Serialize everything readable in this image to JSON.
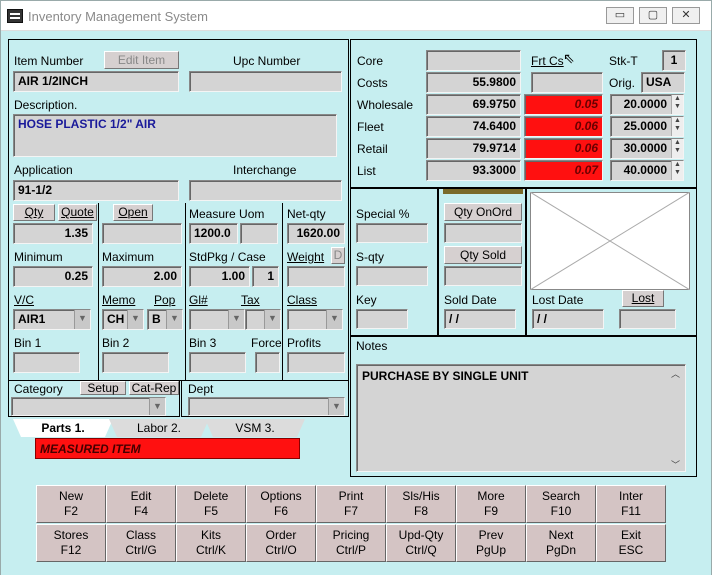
{
  "window": {
    "title": "Inventory Management System",
    "min": "▭",
    "max": "▢",
    "close": "✕"
  },
  "left": {
    "item_number_label": "Item Number",
    "edit_item": "Edit Item",
    "upc_label": "Upc  Number",
    "item_number": "AIR 1/2INCH",
    "upc": "",
    "description_label": "Description.",
    "description": "HOSE PLASTIC 1/2\" AIR",
    "application_label": "Application",
    "interchange_label": "Interchange",
    "application": "91-1/2",
    "interchange": "",
    "qty_btn": "Qty",
    "quote_btn": "Quote",
    "open_btn": "Open",
    "measure_uom_label": "Measure Uom",
    "net_qty_label": "Net-qty",
    "qty": "1.35",
    "open": "",
    "measure_uom": "1200.0",
    "net_qty": "1620.00",
    "minimum_label": "Minimum",
    "maximum_label": "Maximum",
    "stdpkg_label": "StdPkg / Case",
    "weight_label": "Weight",
    "d_label": "D",
    "minimum": "0.25",
    "maximum": "2.00",
    "stdpkg": "1.00",
    "case": "1",
    "weight": "",
    "vc_label": "V/C",
    "memo_label": "Memo",
    "pop_label": "Pop",
    "gl_label": "Gl#",
    "tax_label": "Tax",
    "class_label": "Class",
    "vc": "AIR1",
    "memo": "CH",
    "pop": "B",
    "gl": "",
    "tax": "",
    "class": "",
    "bin1_label": "Bin 1",
    "bin2_label": "Bin 2",
    "bin3_label": "Bin 3",
    "force_label": "Force",
    "profits_label": "Profits",
    "bin1": "",
    "bin2": "",
    "bin3": "",
    "force": "",
    "profits": ""
  },
  "category": {
    "label": "Category",
    "setup": "Setup",
    "catrep": "Cat-Rep",
    "dept_label": "Dept",
    "value": "",
    "dept": ""
  },
  "tabs": [
    {
      "label": "Parts 1."
    },
    {
      "label": "Labor 2."
    },
    {
      "label": "VSM 3."
    }
  ],
  "alert": "MEASURED ITEM",
  "pricing": {
    "core_label": "Core",
    "frt_label": "Frt Cs",
    "stkt_label": "Stk-T",
    "stkt": "1",
    "orig_label": "Orig.",
    "orig": "USA",
    "core": "",
    "frt": "",
    "costs_label": "Costs",
    "costs": "55.9800",
    "rows": [
      {
        "label": "Wholesale",
        "value": "69.9750",
        "margin": "0.05",
        "pct": "20.0000"
      },
      {
        "label": "Fleet",
        "value": "74.6400",
        "margin": "0.06",
        "pct": "25.0000"
      },
      {
        "label": "Retail",
        "value": "79.9714",
        "margin": "0.06",
        "pct": "30.0000"
      },
      {
        "label": "List",
        "value": "93.3000",
        "margin": "0.07",
        "pct": "40.0000"
      }
    ]
  },
  "mid": {
    "special_label": "Special %",
    "qty_onord": "Qty OnOrd",
    "sqty_label": "S-qty",
    "qty_sold": "Qty Sold",
    "key_label": "Key",
    "sold_date_label": "Sold Date",
    "lost_date_label": "Lost Date",
    "lost_btn": "Lost",
    "special": "",
    "onord": "",
    "sqty": "",
    "sold": "",
    "key": "",
    "sold_date": " / /",
    "lost_date": " / /",
    "lost": ""
  },
  "notes": {
    "label": "Notes",
    "text": "PURCHASE BY SINGLE UNIT"
  },
  "fkeys": [
    {
      "l1": "New",
      "l2": "F2"
    },
    {
      "l1": "Edit",
      "l2": "F4"
    },
    {
      "l1": "Delete",
      "l2": "F5"
    },
    {
      "l1": "Options",
      "l2": "F6"
    },
    {
      "l1": "Print",
      "l2": "F7"
    },
    {
      "l1": "Sls/His",
      "l2": "F8"
    },
    {
      "l1": "More",
      "l2": "F9"
    },
    {
      "l1": "Search",
      "l2": "F10"
    },
    {
      "l1": "Inter",
      "l2": "F11"
    },
    {
      "l1": "Stores",
      "l2": "F12"
    },
    {
      "l1": "Class",
      "l2": "Ctrl/G"
    },
    {
      "l1": "Kits",
      "l2": "Ctrl/K"
    },
    {
      "l1": "Order",
      "l2": "Ctrl/O"
    },
    {
      "l1": "Pricing",
      "l2": "Ctrl/P"
    },
    {
      "l1": "Upd-Qty",
      "l2": "Ctrl/Q"
    },
    {
      "l1": "Prev",
      "l2": "PgUp"
    },
    {
      "l1": "Next",
      "l2": "PgDn"
    },
    {
      "l1": "Exit",
      "l2": "ESC"
    }
  ]
}
